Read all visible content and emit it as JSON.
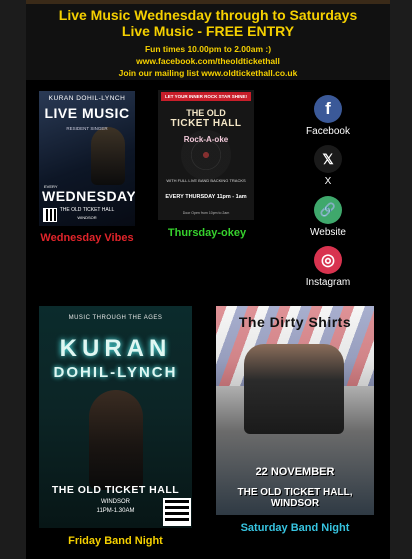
{
  "header": {
    "line1": "Live Music Wednesday through to Saturdays",
    "line2": "Live Music - FREE ENTRY",
    "line3": "Fun times  10.00pm to 2.00am :)",
    "line4": "www.facebook.com/theoldtickethall",
    "line5": "Join our mailing list www.oldtickethall.co.uk"
  },
  "posters": {
    "wednesday": {
      "name": "KURAN DOHIL-LYNCH",
      "title": "LIVE MUSIC",
      "role": "RESIDENT SINGER",
      "every": "EVERY",
      "day": "WEDNESDAY",
      "venue": "THE OLD TICKET HALL",
      "location": "WINDSOR",
      "caption": "Wednesday Vibes"
    },
    "thursday": {
      "banner": "LET YOUR INNER ROCK STAR SHINE!",
      "title1": "THE OLD",
      "title2": "TICKET HALL",
      "rock": "Rock-A-oke",
      "info": "WITH FULL LIVE BAND BACKING TRACKS",
      "every": "EVERY THURSDAY 11pm - 1am",
      "foot": "Door Open from 10pm to 2am",
      "caption": "Thursday-okey"
    },
    "friday": {
      "top": "MUSIC THROUGH THE AGES",
      "name1": "KURAN",
      "name2": "DOHIL-LYNCH",
      "venue": "THE OLD TICKET HALL",
      "location": "WINDSOR",
      "time": "11PM-1.30AM",
      "caption": "Friday Band Night"
    },
    "saturday": {
      "title": "The Dirty Shirts",
      "date": "22 NOVEMBER",
      "venue": "THE OLD TICKET HALL, WINDSOR",
      "caption": "Saturday Band Night"
    }
  },
  "social": [
    {
      "label": "Facebook",
      "glyph": "f",
      "color": "#3b5998"
    },
    {
      "label": "X",
      "glyph": "𝕏",
      "color": "#1a1a1a"
    },
    {
      "label": "Website",
      "glyph": "🔗",
      "color": "#3fa86c"
    },
    {
      "label": "Instagram",
      "glyph": "◎",
      "color": "#d8334f"
    }
  ],
  "caption_colors": {
    "wednesday": "#e0242a",
    "thursday": "#36d12d",
    "friday": "#f5d000",
    "saturday": "#37c4e0"
  }
}
